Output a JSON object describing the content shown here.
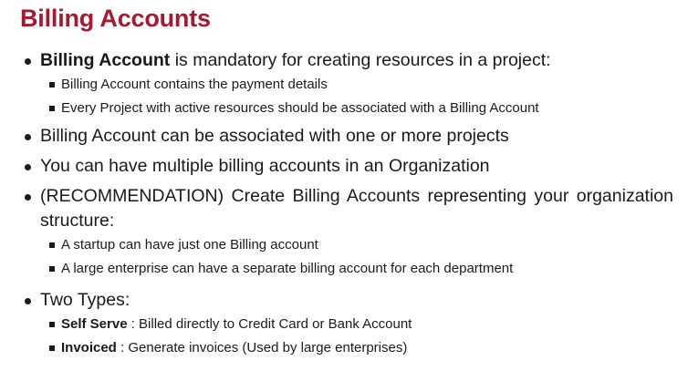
{
  "title": "Billing Accounts",
  "items": [
    {
      "bold": "Billing Account",
      "text": " is mandatory for creating resources in a project:",
      "sub": [
        {
          "text": "Billing Account contains the payment details"
        },
        {
          "text": "Every Project with active resources should be associated with a Billing Account"
        }
      ]
    },
    {
      "text": "Billing Account can be associated with one or more projects"
    },
    {
      "text": "You can have multiple billing accounts in an Organization"
    },
    {
      "text": "(RECOMMENDATION) Create Billing Accounts representing your organization structure:",
      "sub": [
        {
          "text": "A startup can have just one Billing account"
        },
        {
          "text": "A large enterprise can have a separate billing account for each department"
        }
      ]
    },
    {
      "text": "Two Types:",
      "sub": [
        {
          "bold": "Self Serve",
          "text": " : Billed directly to Credit Card or Bank Account"
        },
        {
          "bold": "Invoiced",
          "text": " : Generate invoices (Used by large enterprises)"
        }
      ]
    }
  ]
}
